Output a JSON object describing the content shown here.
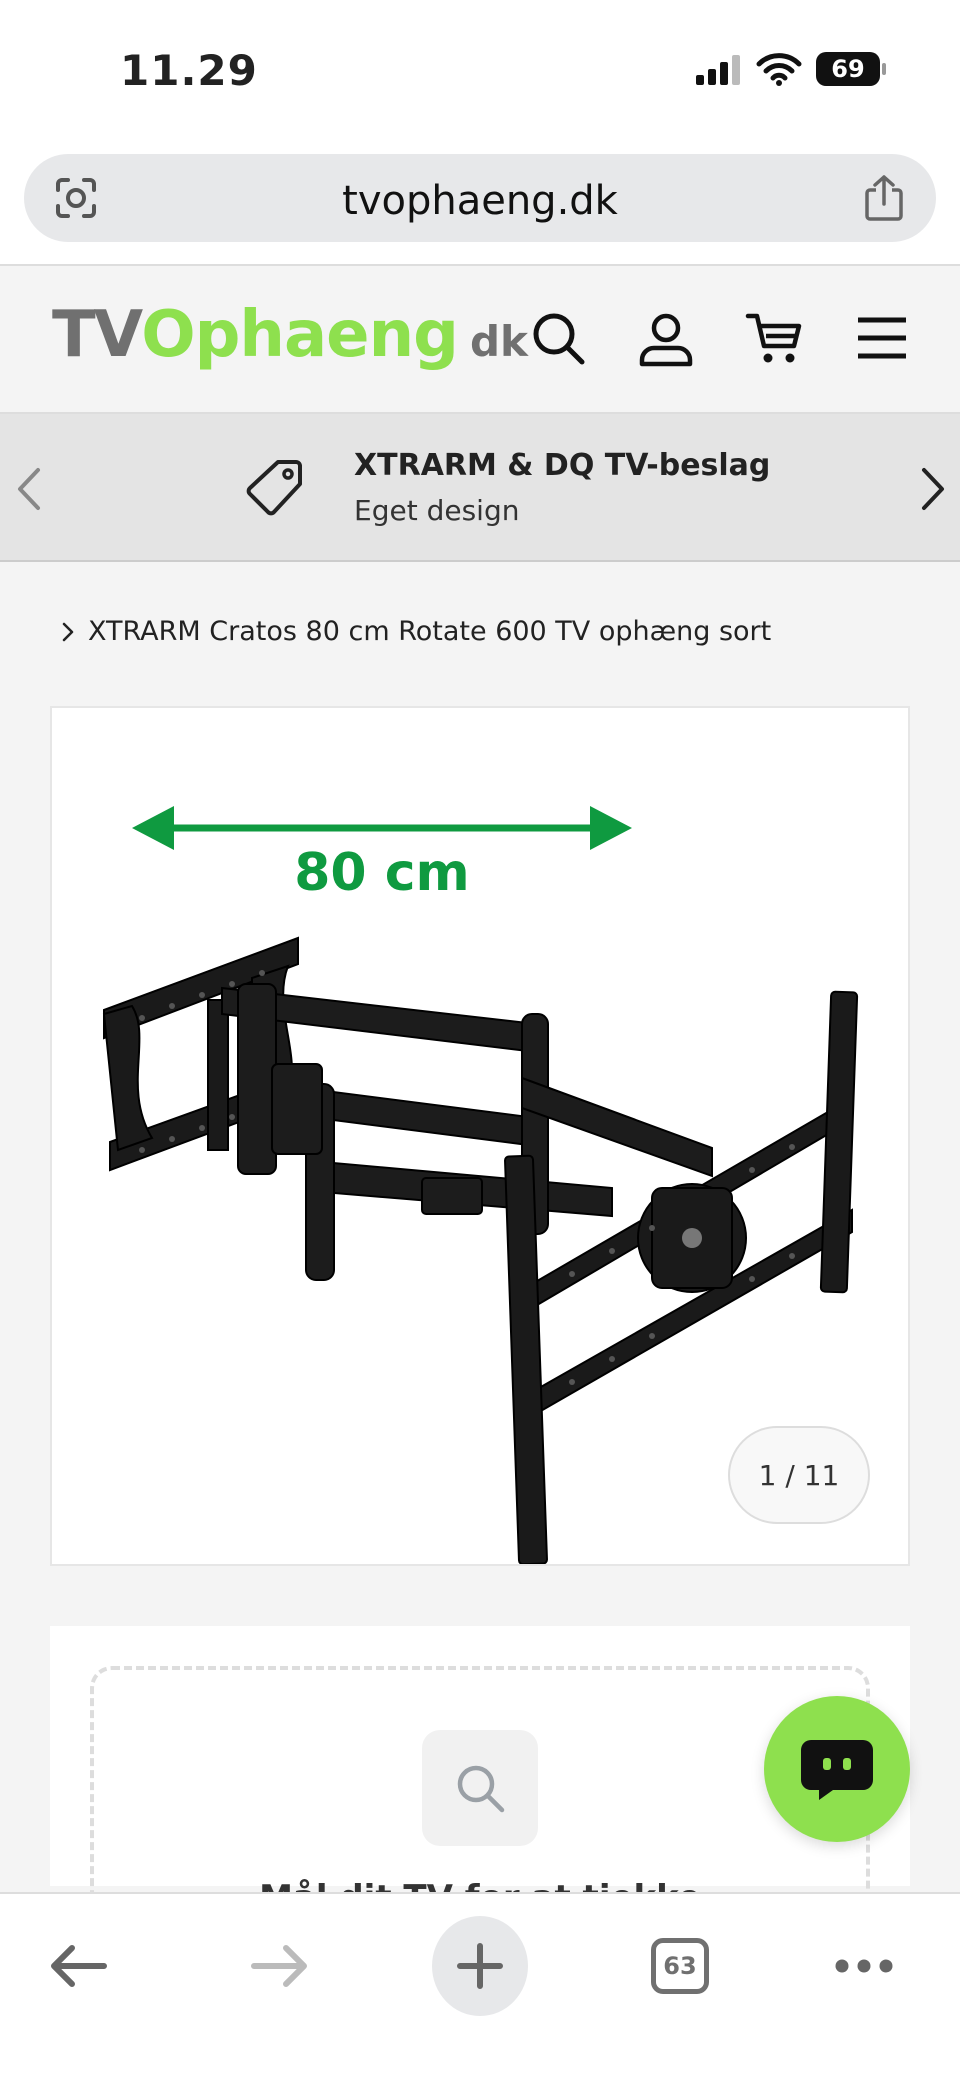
{
  "status_bar": {
    "time": "11.29",
    "battery": "69",
    "icons": [
      "cellular-signal-icon",
      "wifi-icon",
      "battery-icon"
    ]
  },
  "browser": {
    "url": "tvophaeng.dk",
    "tab_count": "63",
    "icons": [
      "lens-icon",
      "share-icon",
      "back-arrow-icon",
      "forward-arrow-icon",
      "plus-icon",
      "tabs-icon",
      "more-icon"
    ]
  },
  "site_header": {
    "logo_tv": "TV",
    "logo_ophaeng": "Ophaeng",
    "logo_dk": "dk",
    "icons": [
      "search-icon",
      "account-icon",
      "cart-icon",
      "menu-icon"
    ]
  },
  "announcement": {
    "title": "XTRARM & DQ TV-beslag",
    "subtitle": "Eget design",
    "icons": [
      "chevron-left-icon",
      "tag-icon",
      "chevron-right-icon"
    ]
  },
  "breadcrumb": {
    "current": "XTRARM Cratos 80 cm Rotate 600 TV ophæng sort"
  },
  "product_image": {
    "dimension_label": "80 cm",
    "counter": "1 / 11",
    "colors": {
      "accent": "#0f9a40"
    }
  },
  "lower_card": {
    "partial_text": "Mål dit TV for at tjekke"
  },
  "colors": {
    "brand_green": "#8ee04e",
    "logo_gray": "#707070"
  }
}
